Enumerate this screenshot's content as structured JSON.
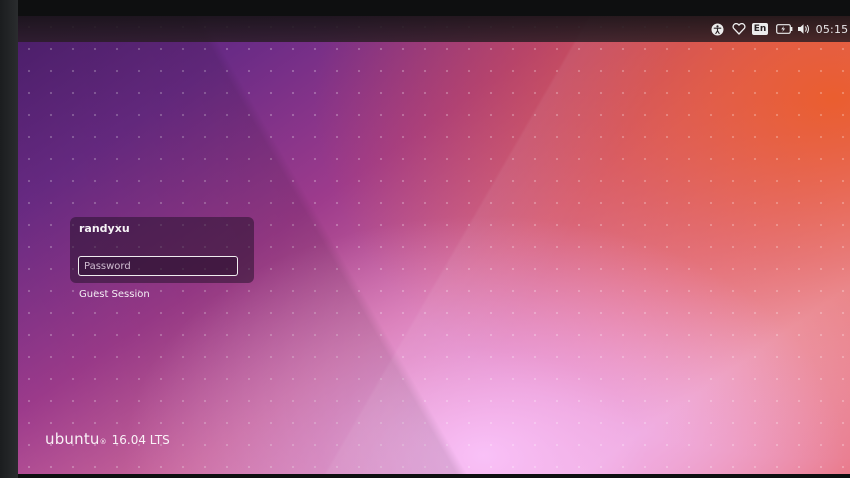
{
  "top_panel": {
    "indicators": {
      "accessibility": "accessibility-icon",
      "network": "network-heart-icon",
      "keyboard_layout": "En",
      "battery": "battery-icon",
      "volume": "volume-icon"
    },
    "clock": "05:15"
  },
  "login": {
    "username": "randyxu",
    "password_placeholder": "Password",
    "guest_session": "Guest Session"
  },
  "branding": {
    "wordmark": "ubuntu",
    "registered": "®",
    "version": "16.04 LTS"
  },
  "colors": {
    "panel_bg": "#2a1c24",
    "gradient_purple": "#6a2b86",
    "gradient_orange": "#e55a2a",
    "gradient_pink": "#f0b3d9"
  }
}
